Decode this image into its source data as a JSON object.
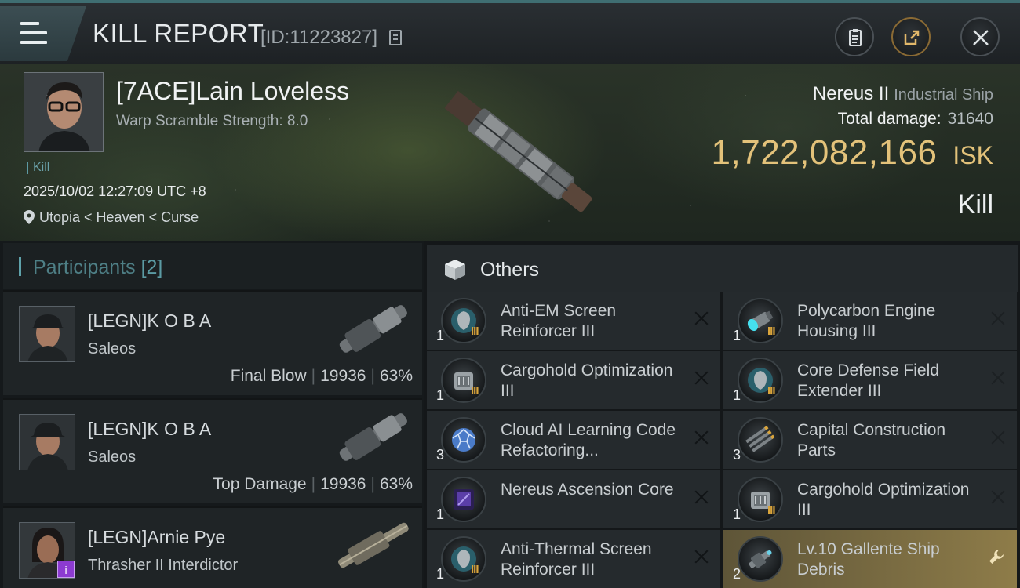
{
  "header": {
    "title": "KILL REPORT",
    "report_id": "[ID:11223827]",
    "menu_icon": "hamburger-icon",
    "clipboard_icon": "clipboard-icon",
    "share_icon": "share-icon",
    "close_icon": "close-icon"
  },
  "victim": {
    "pilot_name": "[7ACE]Lain Loveless",
    "warp_scramble": "Warp Scramble Strength: 8.0",
    "kill_tag": "Kill",
    "datetime": "2025/10/02 12:27:09 UTC +8",
    "location": "Utopia < Heaven < Curse",
    "ship_name": "Nereus II",
    "ship_class": "Industrial Ship",
    "total_damage_label": "Total damage:",
    "total_damage": "31640",
    "isk_value": "1,722,082,166",
    "isk_unit": "ISK",
    "result": "Kill"
  },
  "participants": {
    "title": "Participants",
    "count": "[2]",
    "rows": [
      {
        "name": "[LEGN]K O B A",
        "ship": "Saleos",
        "role": "Final Blow",
        "damage": "19936",
        "percent": "63%"
      },
      {
        "name": "[LEGN]K O B A",
        "ship": "Saleos",
        "role": "Top Damage",
        "damage": "19936",
        "percent": "63%"
      },
      {
        "name": "[LEGN]Arnie Pye",
        "ship": "Thrasher II Interdictor"
      }
    ]
  },
  "others": {
    "title": "Others",
    "items": [
      {
        "name": "Anti-EM Screen Reinforcer III",
        "qty": "1",
        "tier": "III",
        "icon": "shield-module-icon"
      },
      {
        "name": "Polycarbon Engine Housing III",
        "qty": "1",
        "tier": "III",
        "icon": "engine-module-icon"
      },
      {
        "name": "Cargohold Optimization III",
        "qty": "1",
        "tier": "III",
        "icon": "cargo-module-icon"
      },
      {
        "name": "Core Defense Field Extender III",
        "qty": "1",
        "tier": "III",
        "icon": "shield-module-icon"
      },
      {
        "name": "Cloud AI Learning Code Refactoring...",
        "qty": "3",
        "icon": "ai-sphere-icon"
      },
      {
        "name": "Capital Construction Parts",
        "qty": "3",
        "icon": "construction-parts-icon"
      },
      {
        "name": "Nereus Ascension Core",
        "qty": "1",
        "icon": "ascension-core-icon"
      },
      {
        "name": "Cargohold Optimization III",
        "qty": "1",
        "tier": "III",
        "icon": "cargo-module-icon"
      },
      {
        "name": "Anti-Thermal Screen Reinforcer III",
        "qty": "1",
        "tier": "III",
        "icon": "shield-module-icon"
      },
      {
        "name": "Lv.10 Gallente Ship Debris",
        "qty": "2",
        "icon": "ship-debris-icon"
      }
    ]
  },
  "colors": {
    "isk_gold": "#e3c27a",
    "accent_teal": "#5fa2ab",
    "tier_gold": "#d9a43b",
    "highlight_item": "#8e7c49"
  }
}
